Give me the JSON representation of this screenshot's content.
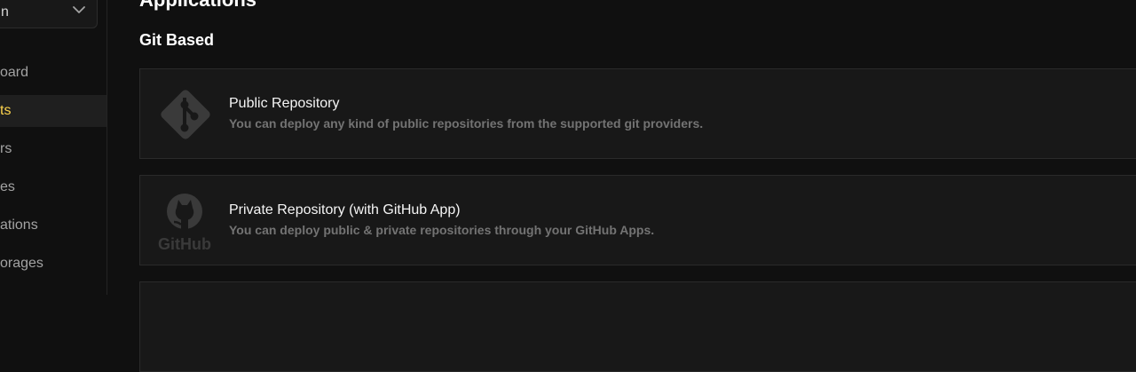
{
  "sidebar": {
    "team_select": {
      "value": "n"
    },
    "items": [
      {
        "label": "oard",
        "active": false
      },
      {
        "label": "ts",
        "active": true
      },
      {
        "label": "rs",
        "active": false
      },
      {
        "label": "es",
        "active": false
      },
      {
        "label": "ations",
        "active": false
      },
      {
        "label": "orages",
        "active": false
      }
    ]
  },
  "main": {
    "page_title": "Applications",
    "section_title": "Git Based",
    "cards": [
      {
        "title": "Public Repository",
        "description": "You can deploy any kind of public repositories from the supported git providers.",
        "icon": "git-icon"
      },
      {
        "title": "Private Repository (with GitHub App)",
        "description": "You can deploy public & private repositories through your GitHub Apps.",
        "icon": "github-icon",
        "icon_text": "GitHub"
      }
    ]
  },
  "colors": {
    "background": "#101010",
    "card": "#181818",
    "active_accent": "#fcd34d",
    "muted_text": "#737373"
  }
}
